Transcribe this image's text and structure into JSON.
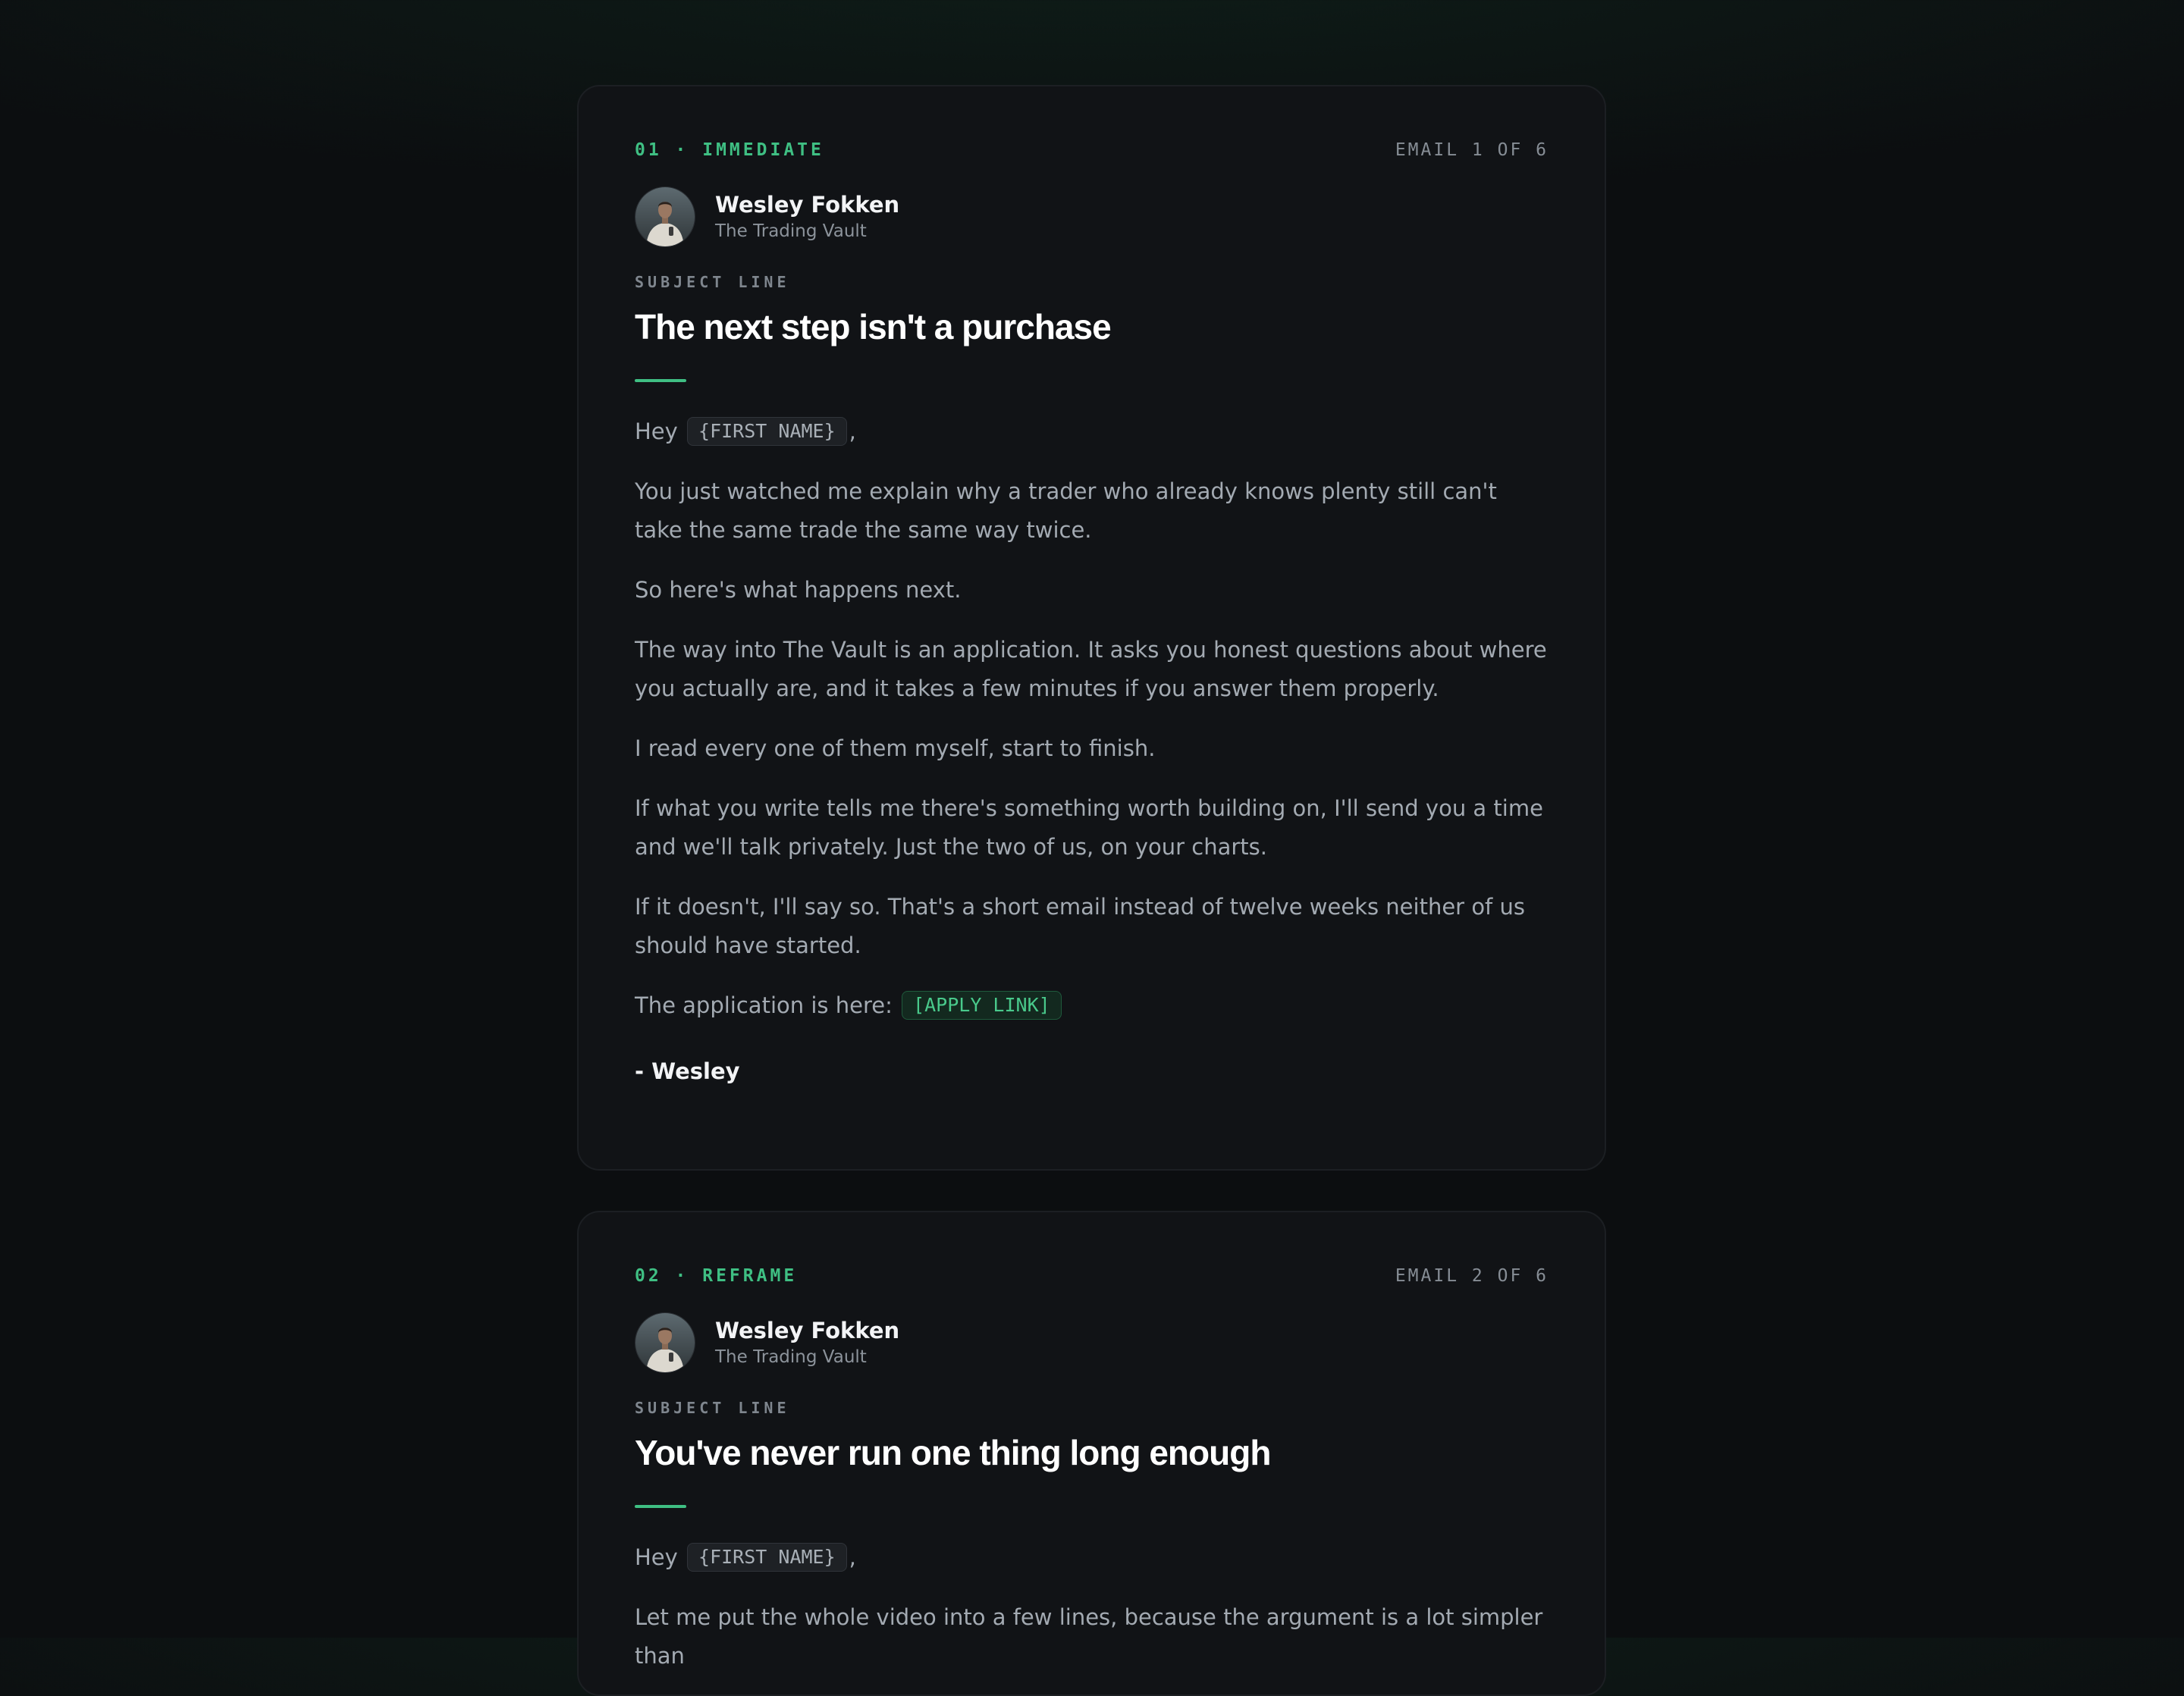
{
  "emails": [
    {
      "tag": "01 · IMMEDIATE",
      "counter": "EMAIL 1 OF 6",
      "sender_name": "Wesley Fokken",
      "sender_org": "The Trading Vault",
      "subject_label": "SUBJECT LINE",
      "subject": "The next step isn't a purchase",
      "greeting_prefix": "Hey",
      "first_name_token": "{FIRST NAME}",
      "greeting_suffix": ",",
      "paragraphs": [
        "You just watched me explain why a trader who already knows plenty still can't take the same trade the same way twice.",
        "So here's what happens next.",
        "The way into The Vault is an application. It asks you honest questions about where you actually are, and it takes a few minutes if you answer them properly.",
        "I read every one of them myself, start to finish.",
        "If what you write tells me there's something worth building on, I'll send you a time and we'll talk privately. Just the two of us, on your charts.",
        "If it doesn't, I'll say so. That's a short email instead of twelve weeks neither of us should have started."
      ],
      "apply_prefix": "The application is here:",
      "apply_token": "[APPLY LINK]",
      "signoff": "- Wesley"
    },
    {
      "tag": "02 · REFRAME",
      "counter": "EMAIL 2 OF 6",
      "sender_name": "Wesley Fokken",
      "sender_org": "The Trading Vault",
      "subject_label": "SUBJECT LINE",
      "subject": "You've never run one thing long enough",
      "greeting_prefix": "Hey",
      "first_name_token": "{FIRST NAME}",
      "greeting_suffix": ",",
      "paragraphs": [
        "Let me put the whole video into a few lines, because the argument is a lot simpler than"
      ]
    }
  ],
  "colors": {
    "accent": "#3fbf83",
    "card_bg": "#111316",
    "page_bg": "#0c0e10",
    "heading": "#ffffff",
    "body_text": "#a3aab2"
  }
}
